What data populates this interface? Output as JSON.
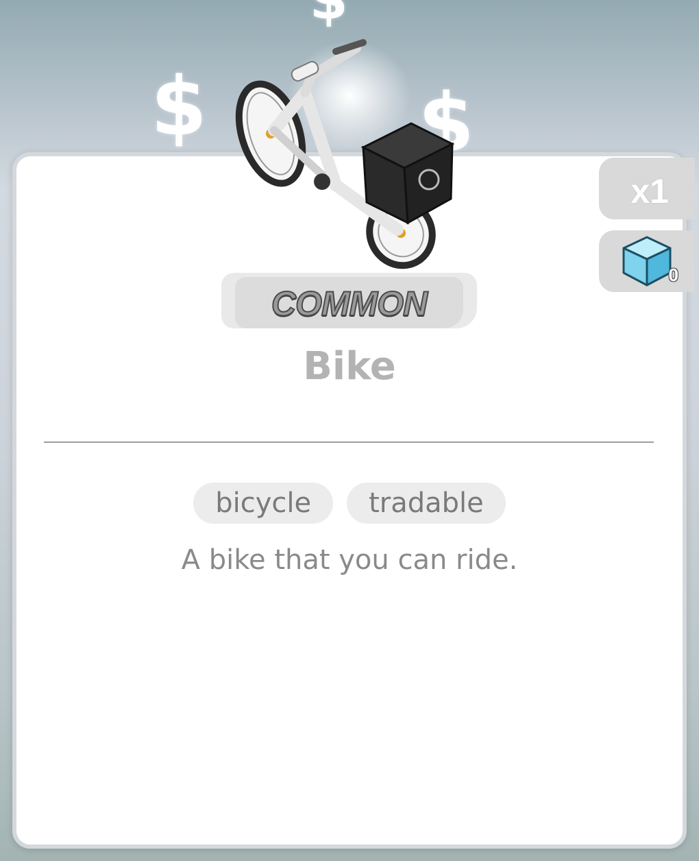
{
  "item": {
    "quantity": "x1",
    "cube_count": "0",
    "rarity": "COMMON",
    "name": "Bike",
    "tags": [
      "bicycle",
      "tradable"
    ],
    "description": "A bike that you can ride."
  },
  "icons": {
    "item_image": "bike-icon",
    "currency": "dollar-sign-icon",
    "cube": "cube-icon"
  },
  "colors": {
    "card_bg": "#ffffff",
    "tab_bg": "#d9d9d9",
    "cube": "#7fd3ec"
  }
}
